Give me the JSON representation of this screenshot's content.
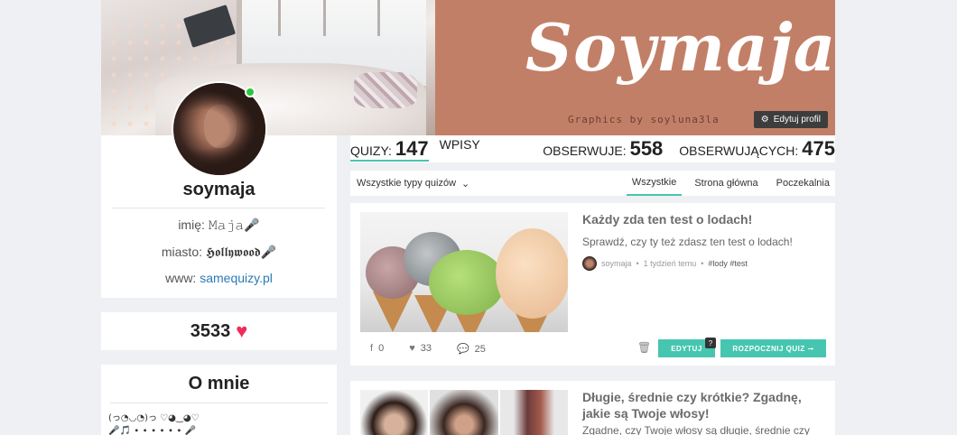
{
  "cover": {
    "title": "Soymaja",
    "subtitle": "Graphics by soyluna3la",
    "edit_profile_label": "Edytuj profil"
  },
  "profile": {
    "username": "soymaja",
    "name_label": "imię:",
    "name_value": "𝙼𝚊𝚓𝚊🎤",
    "city_label": "miasto:",
    "city_value": "𝕳𝖔𝖑𝖑𝖞𝖜𝖔𝖔𝖉🎤",
    "www_label": "www:",
    "www_value": "samequizy.pl",
    "online": true
  },
  "likes": {
    "count": "3533"
  },
  "about": {
    "title": "O mnie",
    "line1": "(っ◔◡◔)っ ♡◕‿◕♡",
    "line2": "🎤🎵 ∙ ∙ ∙ ∙ ∙ ∙ 🎤"
  },
  "stats": {
    "quizy_label": "QUIZY:",
    "quizy_value": "147",
    "wpisy_label": "WPISY",
    "obserwuje_label": "OBSERWUJE:",
    "obserwuje_value": "558",
    "obserwujacych_label": "OBSERWUJĄCYCH:",
    "obserwujacych_value": "475"
  },
  "filters": {
    "type_select": "Wszystkie typy quizów",
    "tabs": [
      "Wszystkie",
      "Strona główna",
      "Poczekalnia"
    ],
    "active_tab": "Wszystkie"
  },
  "quizzes": [
    {
      "title": "Każdy zda ten test o lodach!",
      "description": "Sprawdź, czy ty też zdasz ten test o lodach!",
      "author": "soymaja",
      "time": "1 tydzień temu",
      "tags": "#lody #test",
      "shares": "0",
      "likes": "33",
      "comments": "25",
      "edit_label": "EDYTUJ",
      "edit_badge": "?",
      "start_label": "ROZPOCZNIJ QUIZ ➞"
    },
    {
      "title": "Długie, średnie czy krótkie? Zgadnę, jakie są Twoje włosy!",
      "description": "Zgadne, czy Twoje włosy są długie, średnie czy"
    }
  ],
  "colors": {
    "accent": "#46c6b0",
    "cover_brand": "#c27f67",
    "heart": "#ee2b5a",
    "online": "#2ec43b",
    "link": "#2a7ab8"
  }
}
